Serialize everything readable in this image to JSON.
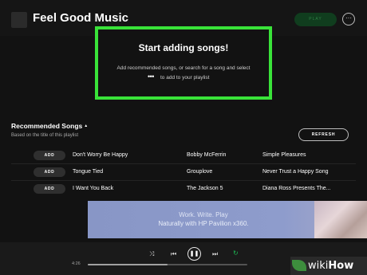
{
  "header": {
    "title": "Feel Good Music",
    "play_label": "PLAY",
    "more_glyph": "···"
  },
  "empty_state": {
    "title": "Start adding songs!",
    "line1": "Add recommended songs, or search for a song and select",
    "dots": "•••",
    "line2": "to add to your playlist"
  },
  "recommended": {
    "title": "Recommended Songs",
    "caret": "▲",
    "subtitle": "Based on the title of this playlist",
    "refresh_label": "REFRESH",
    "add_label": "ADD",
    "rows": [
      {
        "song": "Don't Worry Be Happy",
        "artist": "Bobby McFerrin",
        "album": "Simple Pleasures"
      },
      {
        "song": "Tongue Tied",
        "artist": "Grouplove",
        "album": "Never Trust a Happy Song"
      },
      {
        "song": "I Want You Back",
        "artist": "The Jackson 5",
        "album": "Diana Ross Presents The..."
      }
    ]
  },
  "ad": {
    "line1": "Work. Write. Play",
    "line2": "Naturally with HP Pavilion x360."
  },
  "player": {
    "elapsed": "4:26",
    "progress": 0.5,
    "shuffle_icon": "⤨",
    "prev_icon": "⏮",
    "play_pause_icon": "❚❚",
    "next_icon": "⏭",
    "repeat_icon": "↻",
    "repeat_color": "#1db954"
  },
  "watermark": {
    "prefix": "wiki",
    "suffix": "How"
  }
}
